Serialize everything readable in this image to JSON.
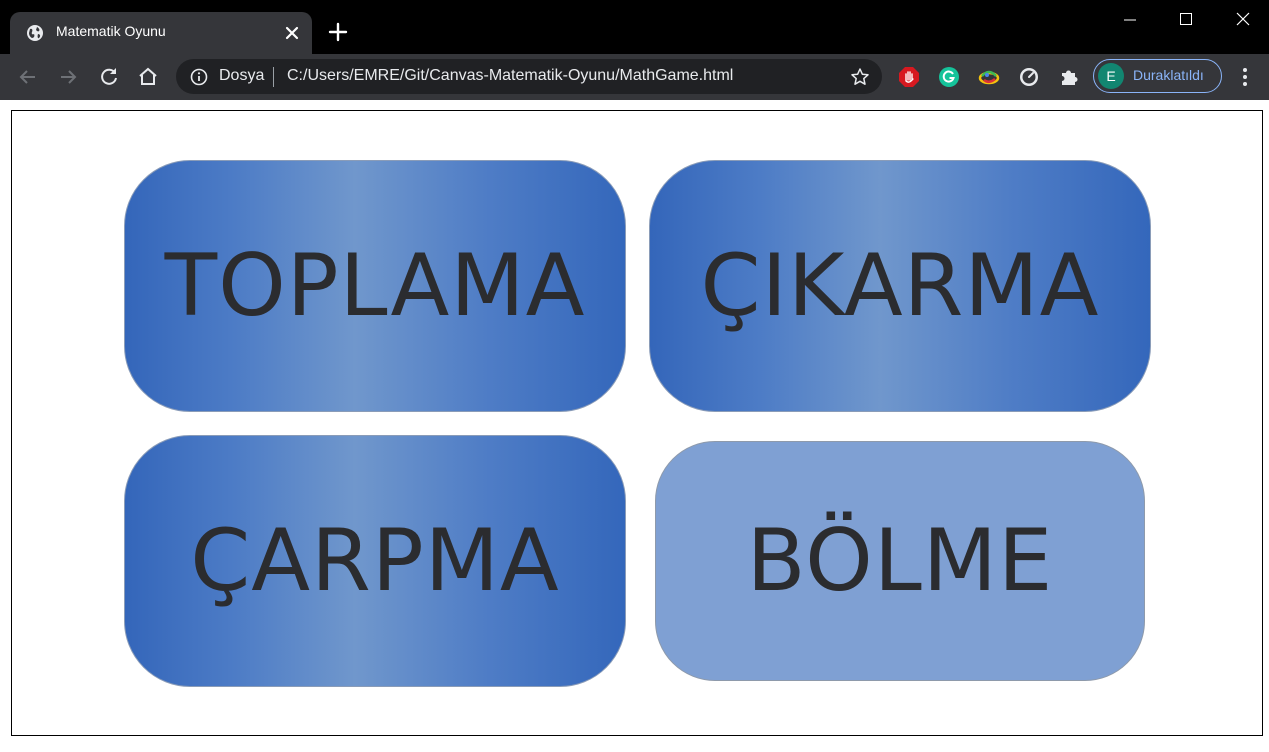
{
  "browser": {
    "tab_title": "Matematik Oyunu",
    "omnibox": {
      "security_label": "Dosya",
      "url": "C:/Users/EMRE/Git/Canvas-Matematik-Oyunu/MathGame.html"
    },
    "profile": {
      "initial": "E",
      "label": "Duraklatıldı"
    },
    "extensions": [
      "stop-hand-icon",
      "grammarly-icon",
      "colorful-ring-icon",
      "gauge-icon",
      "puzzle-icon"
    ]
  },
  "game": {
    "buttons": [
      {
        "id": "toplama",
        "label": "TOPLAMA"
      },
      {
        "id": "cikarma",
        "label": "ÇIKARMA"
      },
      {
        "id": "carpma",
        "label": "ÇARPMA"
      },
      {
        "id": "bolme",
        "label": "BÖLME"
      }
    ]
  },
  "colors": {
    "button_gradient_edge": "#3466ba",
    "button_gradient_center": "#7097cc",
    "button_dim": "#7fa0d3",
    "label_text": "#2b2c2f"
  }
}
